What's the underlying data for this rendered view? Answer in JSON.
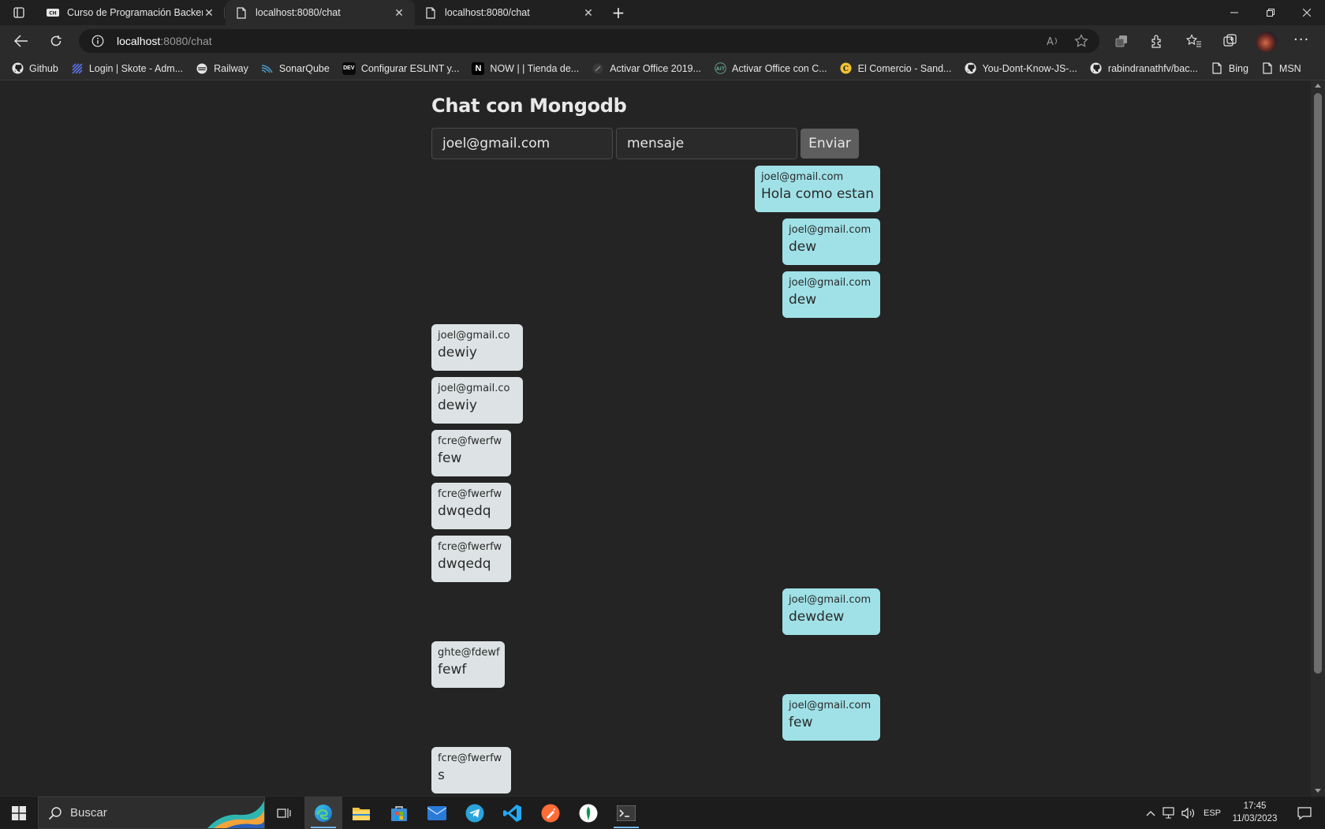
{
  "browser": {
    "tabs": [
      {
        "title": "Curso de Programación Backend",
        "favicon": "coderhouse-icon"
      },
      {
        "title": "localhost:8080/chat",
        "favicon": "page-icon"
      },
      {
        "title": "localhost:8080/chat",
        "favicon": "page-icon"
      }
    ],
    "address": {
      "host": "localhost",
      "path": ":8080/chat"
    },
    "bookmarks": [
      {
        "label": "Github",
        "icon": "github-icon"
      },
      {
        "label": "Login | Skote - Adm...",
        "icon": "skote-icon"
      },
      {
        "label": "Railway",
        "icon": "railway-icon"
      },
      {
        "label": "SonarQube",
        "icon": "sonarqube-icon"
      },
      {
        "label": "Configurar ESLINT y...",
        "icon": "dev-icon"
      },
      {
        "label": "NOW | | Tienda de...",
        "icon": "now-icon"
      },
      {
        "label": "Activar Office 2019...",
        "icon": "office-icon"
      },
      {
        "label": "Activar Office con C...",
        "icon": "ait-icon"
      },
      {
        "label": "El Comercio - Sand...",
        "icon": "elcomercio-icon"
      },
      {
        "label": "You-Dont-Know-JS-...",
        "icon": "github-icon"
      },
      {
        "label": "rabindranathfv/bac...",
        "icon": "github-icon"
      },
      {
        "label": "Bing",
        "icon": "page-icon"
      },
      {
        "label": "MSN",
        "icon": "page-icon"
      }
    ]
  },
  "chat": {
    "title": "Chat con Mongodb",
    "email_value": "joel@gmail.com",
    "message_value": "mensaje",
    "send_label": "Enviar",
    "messages": [
      {
        "author": "joel@gmail.com",
        "text": "Hola como estan",
        "own": true
      },
      {
        "author": "joel@gmail.com",
        "text": "dew",
        "own": true
      },
      {
        "author": "joel@gmail.com",
        "text": "dew",
        "own": true
      },
      {
        "author": "joel@gmail.co",
        "text": "dewiy",
        "own": false
      },
      {
        "author": "joel@gmail.co",
        "text": "dewiy",
        "own": false
      },
      {
        "author": "fcre@fwerfw",
        "text": "few",
        "own": false
      },
      {
        "author": "fcre@fwerfw",
        "text": "dwqedq",
        "own": false
      },
      {
        "author": "fcre@fwerfw",
        "text": "dwqedq",
        "own": false
      },
      {
        "author": "joel@gmail.com",
        "text": "dewdew",
        "own": true
      },
      {
        "author": "ghte@fdewf",
        "text": "fewf",
        "own": false
      },
      {
        "author": "joel@gmail.com",
        "text": "few",
        "own": true
      },
      {
        "author": "fcre@fwerfw",
        "text": "s",
        "own": false
      }
    ],
    "colors": {
      "own_bubble": "#9fe1e7",
      "other_bubble": "#dde3e4",
      "background": "#242424"
    }
  },
  "taskbar": {
    "search_placeholder": "Buscar",
    "apps": [
      "task-view-icon",
      "edge-icon",
      "file-explorer-icon",
      "store-icon",
      "mail-icon",
      "telegram-icon",
      "vscode-icon",
      "postman-icon",
      "mongodb-compass-icon",
      "terminal-icon"
    ],
    "language": "ESP",
    "time": "17:45",
    "date": "11/03/2023"
  }
}
